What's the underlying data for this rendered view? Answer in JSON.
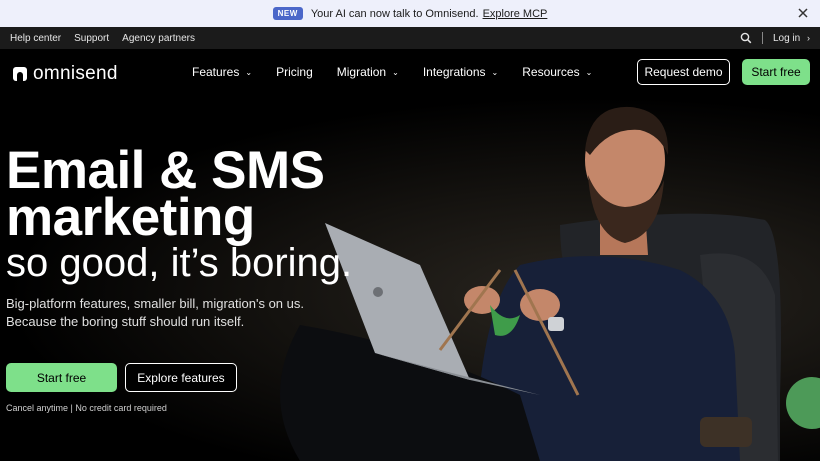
{
  "announcement": {
    "badge": "NEW",
    "text": "Your AI can now talk to Omnisend.",
    "link": "Explore MCP"
  },
  "utility": {
    "links": [
      "Help center",
      "Support",
      "Agency partners"
    ],
    "login": "Log in"
  },
  "nav": {
    "brand": "omnisend",
    "items": [
      {
        "label": "Features",
        "dropdown": true
      },
      {
        "label": "Pricing",
        "dropdown": false
      },
      {
        "label": "Migration",
        "dropdown": true
      },
      {
        "label": "Integrations",
        "dropdown": true
      },
      {
        "label": "Resources",
        "dropdown": true
      }
    ],
    "request_demo": "Request demo",
    "start_free": "Start free"
  },
  "hero": {
    "headline_line1": "Email & SMS",
    "headline_line2": "marketing",
    "headline_light": "so good, it’s boring.",
    "subtext_line1": "Big-platform features, smaller bill, migration's on us.",
    "subtext_line2": "Because the boring stuff should run itself.",
    "cta_primary": "Start free",
    "cta_secondary": "Explore features",
    "fine_print": "Cancel anytime | No credit card required"
  },
  "colors": {
    "accent_green": "#7ee08a",
    "badge_blue": "#4b67c9",
    "announce_bg": "#eef0fb"
  },
  "icons": {
    "close": "close-icon",
    "search": "search-icon",
    "chevron": "chevron-down-icon",
    "login_arrow": "chevron-right-icon"
  }
}
